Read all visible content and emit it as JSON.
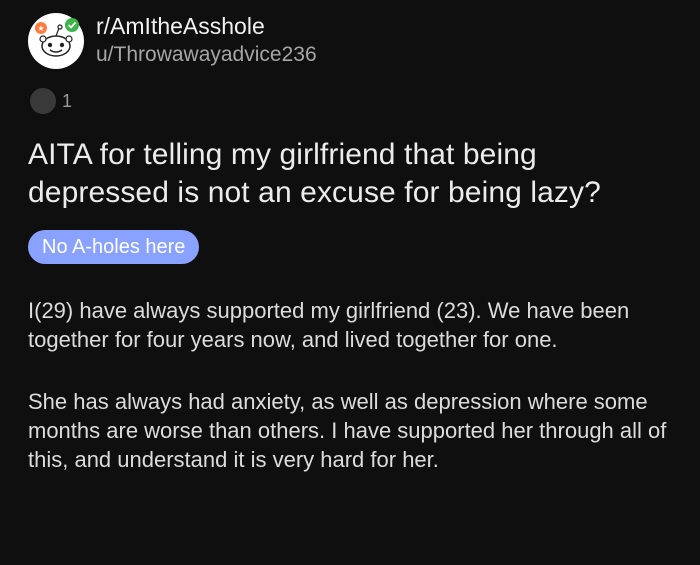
{
  "post": {
    "subreddit": "r/AmItheAsshole",
    "username": "u/Throwawayadvice236",
    "award_count": "1",
    "title": "AITA for telling my girlfriend that being depressed is not an excuse for being lazy?",
    "flair": "No A-holes here",
    "paragraphs": [
      "I(29) have always supported my girlfriend (23). We have been together for four years now, and lived together for one.",
      "She has always had anxiety, as well as depression where some months are worse than others. I have supported her through all of this, and understand it is very hard for her."
    ]
  },
  "colors": {
    "background": "#0f0f0f",
    "flair_background": "#8aa2ff",
    "secondary_text": "#a6a6a6"
  },
  "icons": {
    "avatar": "reddit-snoo-avatar-icon",
    "award": "award-icon"
  }
}
